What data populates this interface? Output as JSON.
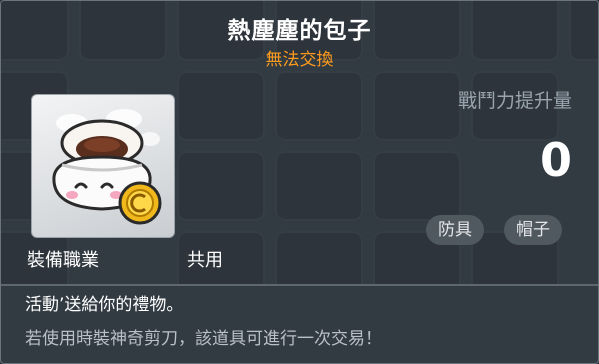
{
  "item": {
    "name": "熱塵塵的包子",
    "trade_status": "無法交換",
    "trade_status_color": "#ff9c1e",
    "icon": "steamed-bun-icon"
  },
  "stats": {
    "power_label": "戰鬥力提升量",
    "power_value": "0"
  },
  "tags": [
    "防具",
    "帽子"
  ],
  "requirement": {
    "label": "裝備職業",
    "value": "共用"
  },
  "description": {
    "line1": "活動’送給你的禮物。",
    "line2": "若使用時裝神奇剪刀，該道具可進行一次交易！"
  }
}
